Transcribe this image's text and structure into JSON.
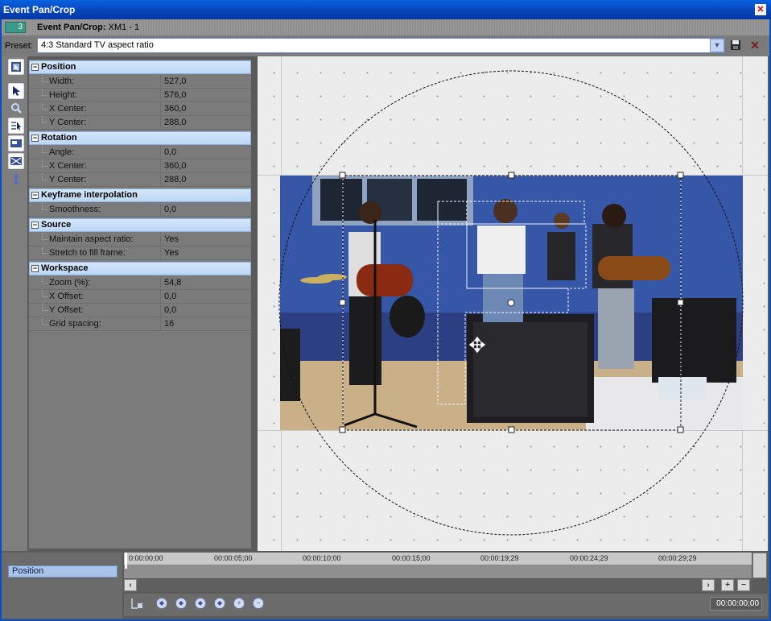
{
  "window": {
    "title": "Event Pan/Crop",
    "close_icon": "close-icon"
  },
  "header": {
    "track_number": "3",
    "title": "Event Pan/Crop:",
    "subtitle": "XM1 - 1"
  },
  "preset": {
    "label": "Preset:",
    "value": "4:3 Standard TV aspect ratio"
  },
  "tools": [
    "normal-edit-icon",
    "select-icon",
    "zoom-icon",
    "snap-icon",
    "source-icon",
    "mask-icon",
    "move-vertical-icon"
  ],
  "properties": [
    {
      "category": "Position",
      "rows": [
        {
          "key": "Width:",
          "value": "527,0"
        },
        {
          "key": "Height:",
          "value": "576,0"
        },
        {
          "key": "X Center:",
          "value": "360,0"
        },
        {
          "key": "Y Center:",
          "value": "288,0"
        }
      ]
    },
    {
      "category": "Rotation",
      "rows": [
        {
          "key": "Angle:",
          "value": "0,0"
        },
        {
          "key": "X Center:",
          "value": "360,0"
        },
        {
          "key": "Y Center:",
          "value": "288,0"
        }
      ]
    },
    {
      "category": "Keyframe interpolation",
      "rows": [
        {
          "key": "Smoothness:",
          "value": "0,0"
        }
      ]
    },
    {
      "category": "Source",
      "rows": [
        {
          "key": "Maintain aspect ratio:",
          "value": "Yes"
        },
        {
          "key": "Stretch to fill frame:",
          "value": "Yes"
        }
      ]
    },
    {
      "category": "Workspace",
      "rows": [
        {
          "key": "Zoom (%):",
          "value": "54,8"
        },
        {
          "key": "X Offset:",
          "value": "0,0"
        },
        {
          "key": "Y Offset:",
          "value": "0,0"
        },
        {
          "key": "Grid spacing:",
          "value": "16"
        }
      ]
    }
  ],
  "timeline": {
    "track_label": "Position",
    "ticks": [
      "0:00:00;00",
      "00:00:05;00",
      "00:00:10;00",
      "00:00:15;00",
      "00:00:19;29",
      "00:00:24;29",
      "00:00:29;29"
    ],
    "current_time": "00:00:00;00"
  }
}
